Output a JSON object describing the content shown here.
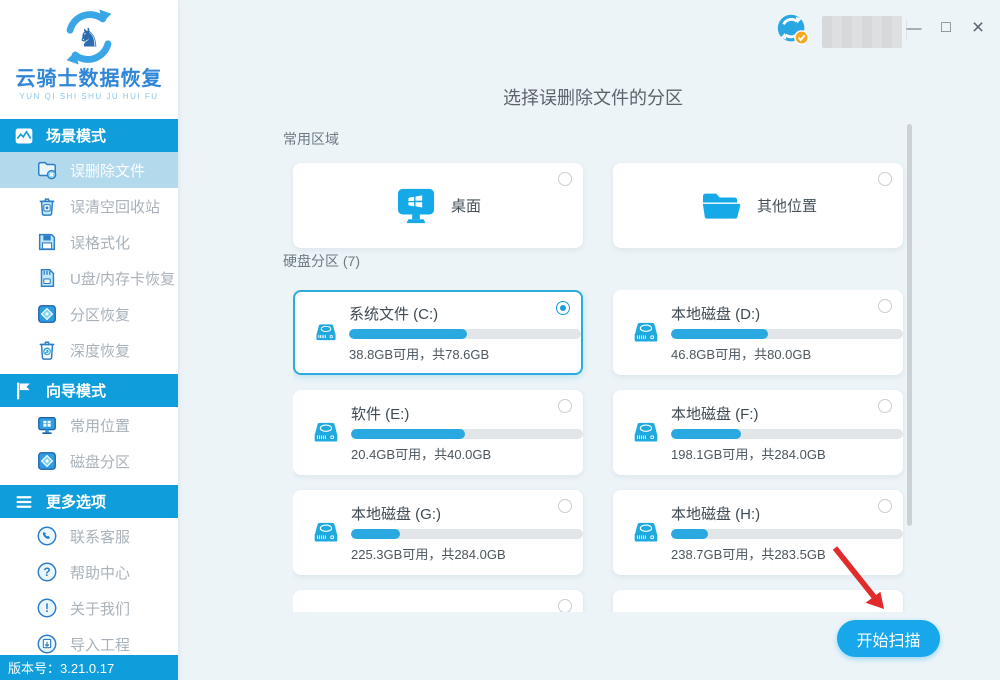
{
  "window": {
    "control_glyphs": {
      "minimize": "—",
      "maximize": "□",
      "close": "×"
    }
  },
  "sidebar": {
    "logo": {
      "title": "云骑士数据恢复",
      "tagline": "YUN QI SHI SHU JU HUI FU"
    },
    "sections": [
      {
        "label": "场景模式",
        "items": [
          {
            "label": "误删除文件",
            "selected": true
          },
          {
            "label": "误清空回收站"
          },
          {
            "label": "误格式化"
          },
          {
            "label": "U盘/内存卡恢复"
          },
          {
            "label": "分区恢复"
          },
          {
            "label": "深度恢复"
          }
        ]
      },
      {
        "label": "向导模式",
        "items": [
          {
            "label": "常用位置"
          },
          {
            "label": "磁盘分区"
          }
        ]
      },
      {
        "label": "更多选项",
        "items": [
          {
            "label": "联系客服"
          },
          {
            "label": "帮助中心"
          },
          {
            "label": "关于我们"
          },
          {
            "label": "导入工程"
          }
        ]
      }
    ],
    "version": "版本号：3.21.0.17"
  },
  "main": {
    "title": "选择误删除文件的分区",
    "common_area": {
      "label": "常用区域",
      "items": [
        {
          "label": "桌面"
        },
        {
          "label": "其他位置"
        }
      ]
    },
    "partition_area": {
      "label": "硬盘分区 (7)"
    },
    "partitions": [
      {
        "name": "系统文件 (C:)",
        "usage": "38.8GB可用，共78.6GB",
        "used_percent": 51,
        "selected": true
      },
      {
        "name": "本地磁盘 (D:)",
        "usage": "46.8GB可用，共80.0GB",
        "used_percent": 42
      },
      {
        "name": "软件 (E:)",
        "usage": "20.4GB可用，共40.0GB",
        "used_percent": 49
      },
      {
        "name": "本地磁盘 (F:)",
        "usage": "198.1GB可用，共284.0GB",
        "used_percent": 30
      },
      {
        "name": "本地磁盘 (G:)",
        "usage": "225.3GB可用，共284.0GB",
        "used_percent": 21
      },
      {
        "name": "本地磁盘 (H:)",
        "usage": "238.7GB可用，共283.5GB",
        "used_percent": 16
      }
    ],
    "scan_button_label": "开始扫描"
  },
  "colors": {
    "accent": "#0f9ddb",
    "button": "#17a7ea",
    "selected_border": "#2bacdf",
    "progress_fill": "#29a9e0",
    "arrow_red": "#e12a2a",
    "icon_blue": "#16a9e8"
  }
}
